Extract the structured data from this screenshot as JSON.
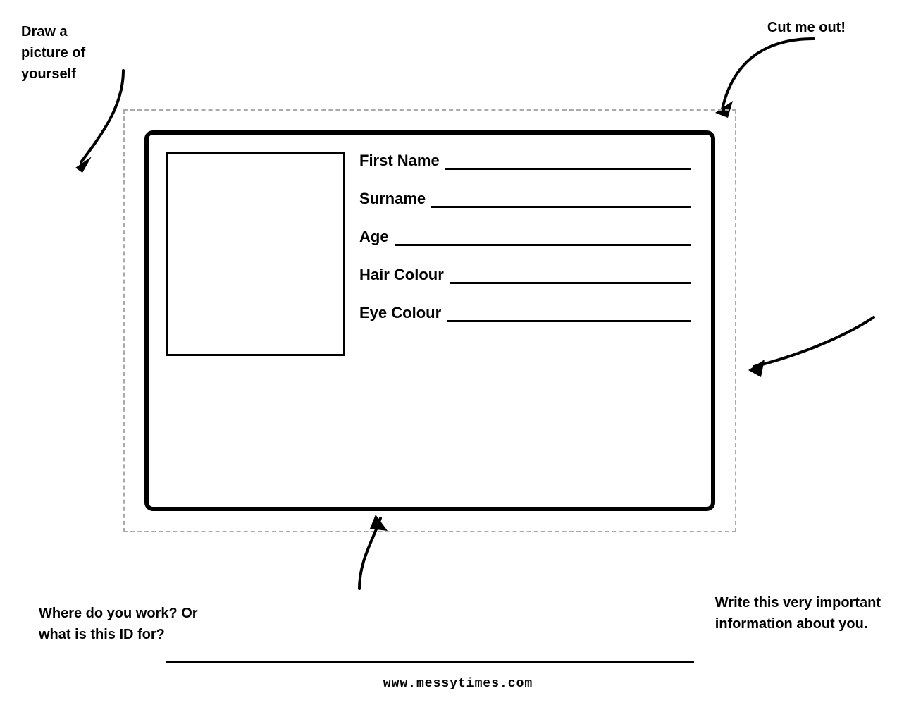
{
  "instructions": {
    "top_left": {
      "line1": "Draw a",
      "line2": "picture of",
      "line3": "yourself"
    },
    "cut_me_out": "Cut me out!",
    "bottom_left": {
      "line1": "Where do you work? Or",
      "line2": "what is this ID for?"
    },
    "bottom_right": {
      "line1": "Write this very important",
      "line2": "information about you."
    }
  },
  "id_card": {
    "fields": [
      {
        "label": "First Name"
      },
      {
        "label": "Surname"
      },
      {
        "label": "Age"
      },
      {
        "label": "Hair Colour"
      },
      {
        "label": "Eye Colour"
      }
    ]
  },
  "footer": {
    "website": "www.messytimes.com"
  }
}
